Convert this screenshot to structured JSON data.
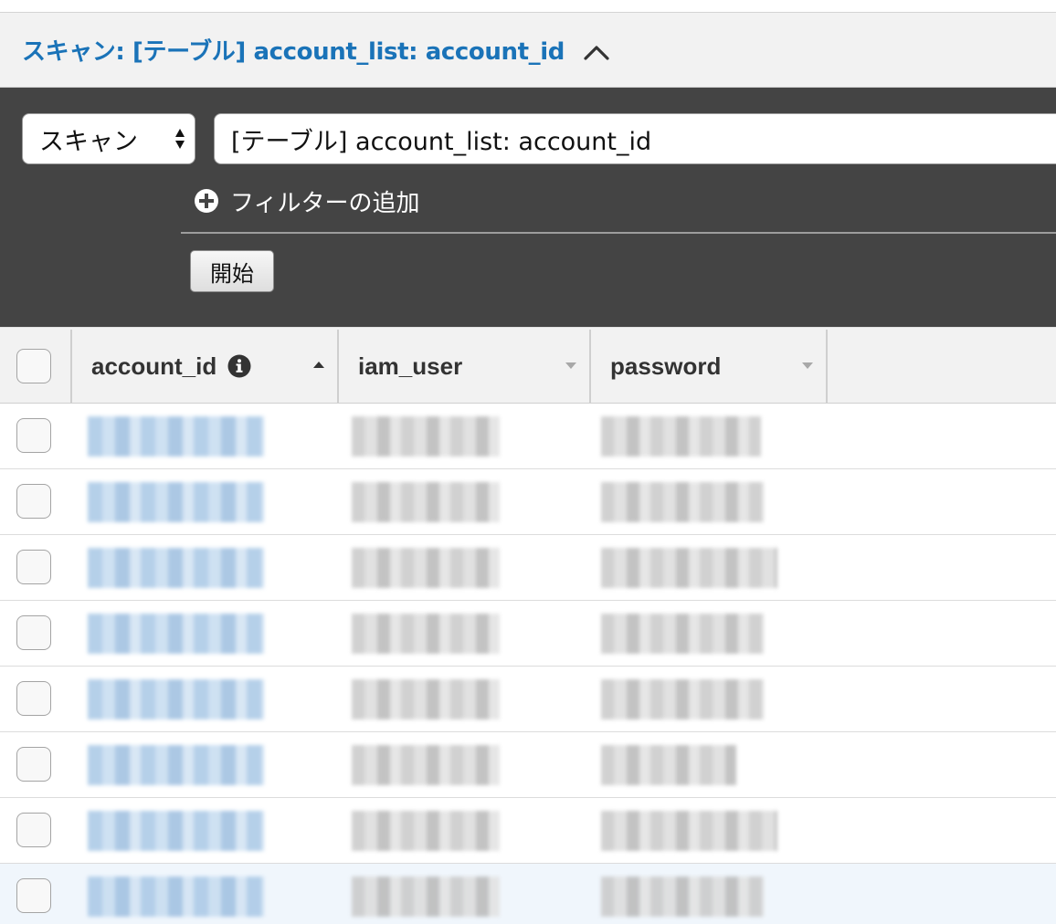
{
  "scan_section": {
    "title": "スキャン: [テーブル] account_list: account_id",
    "collapse_icon": "chevron-up-icon"
  },
  "scan_panel": {
    "mode_value": "スキャン",
    "table_value": "[テーブル] account_list: account_id",
    "add_filter_label": "フィルターの追加",
    "start_button_label": "開始"
  },
  "table": {
    "columns": [
      {
        "label": "account_id",
        "sort": "ascending",
        "icon": "info-icon"
      },
      {
        "label": "iam_user",
        "sort": "none"
      },
      {
        "label": "password",
        "sort": "none"
      }
    ],
    "rows": [
      {
        "selected": false
      },
      {
        "selected": false
      },
      {
        "selected": false
      },
      {
        "selected": false
      },
      {
        "selected": false
      },
      {
        "selected": false
      },
      {
        "selected": false
      },
      {
        "selected": false,
        "hovered": true
      }
    ]
  },
  "colors": {
    "accent": "#1a73b8",
    "panel_bg": "#444444",
    "header_bg": "#f2f2f2"
  }
}
